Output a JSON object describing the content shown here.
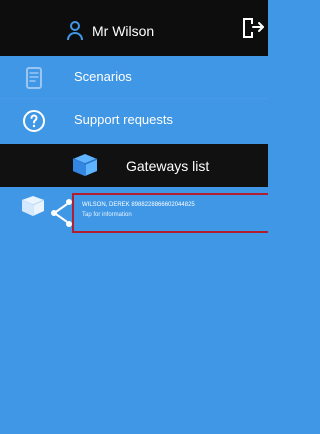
{
  "header": {
    "user_name": "Mr Wilson"
  },
  "menu": {
    "items": [
      {
        "label": "Scenarios"
      },
      {
        "label": "Support requests"
      }
    ],
    "section_title": "Gateways list"
  },
  "gateway": {
    "title": "WILSON, DEREK 8988228866602044825",
    "subtitle": "Tap for information"
  }
}
